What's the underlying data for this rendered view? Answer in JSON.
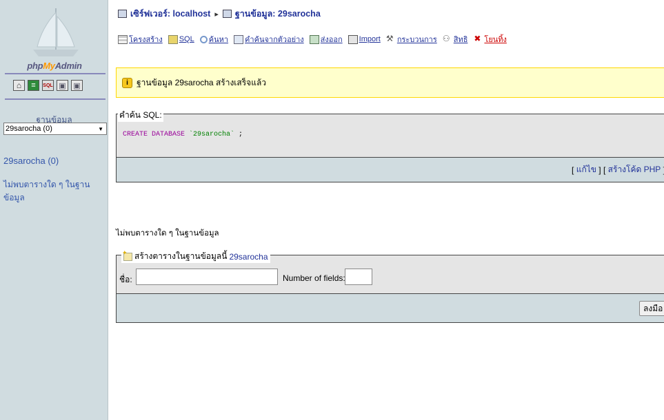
{
  "sidebar": {
    "logo": {
      "php": "php",
      "my": "My",
      "admin": "Admin"
    },
    "quick_icons": [
      "home-icon",
      "sql-query-icon",
      "sql-window-icon",
      "docs-icon",
      "help-icon"
    ],
    "db_label": "ฐานข้อมูล",
    "db_select_value": "29sarocha (0)",
    "current_db": "29sarocha (0)",
    "no_tables_text": "ไม่พบตารางใด ๆ ในฐานข้อมูล"
  },
  "breadcrumb": {
    "server_label": "เซิร์ฟเวอร์: localhost",
    "db_label": "ฐานข้อมูล: 29sarocha"
  },
  "tabs": [
    {
      "label": "โครงสร้าง",
      "icon": "structure-icon"
    },
    {
      "label": "SQL",
      "icon": "sql-icon"
    },
    {
      "label": "ค้นหา",
      "icon": "search-icon"
    },
    {
      "label": "คำค้นจากตัวอย่าง",
      "icon": "query-icon"
    },
    {
      "label": "ส่งออก",
      "icon": "export-icon"
    },
    {
      "label": "Import",
      "icon": "import-icon"
    },
    {
      "label": "กระบวนการ",
      "icon": "operations-icon"
    },
    {
      "label": "สิทธิ",
      "icon": "privileges-icon"
    },
    {
      "label": "โยนทิ้ง",
      "icon": "drop-icon"
    }
  ],
  "notice": {
    "text": "ฐานข้อมูล 29sarocha สร้างเสร็จแล้ว"
  },
  "sql_query": {
    "legend": "คำค้น SQL:",
    "keyword": "CREATE DATABASE",
    "name": "`29sarocha`",
    "terminator": " ;",
    "edit_link": "แก้ไข",
    "php_link": "สร้างโค้ด PHP"
  },
  "no_tables_main": "ไม่พบตารางใด ๆ ในฐานข้อมูล",
  "create_table": {
    "legend_prefix": "สร้างตารางในฐานข้อมูลนี้",
    "db_name": "29sarocha",
    "name_label": "ชื่อ:",
    "name_value": "",
    "fields_label": "Number of fields:",
    "fields_value": "",
    "go_label": "ลงมือ"
  },
  "colors": {
    "sidebar_bg": "#d0dce0",
    "notice_bg": "#ffffcc",
    "fieldset_bg": "#e5e5e5",
    "link": "#223399",
    "logo_accent": "#ff9900"
  }
}
